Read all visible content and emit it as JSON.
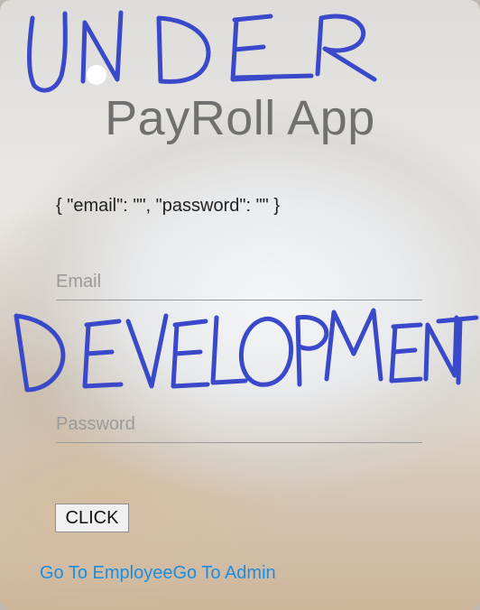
{
  "app": {
    "title": "PayRoll App"
  },
  "form": {
    "state_display": "{ \"email\": \"\", \"password\": \"\" }",
    "email_placeholder": "Email",
    "email_value": "",
    "password_placeholder": "Password",
    "password_value": "",
    "submit_label": "CLICK"
  },
  "nav": {
    "employee_link": "Go To Employee",
    "admin_link": "Go To Admin"
  },
  "overlay": {
    "handwritten_text": [
      "UNDER",
      "DEVELOPMENT"
    ],
    "ink_color": "#3a49c9"
  },
  "colors": {
    "link": "#1c8ee0",
    "title": "#707070"
  }
}
